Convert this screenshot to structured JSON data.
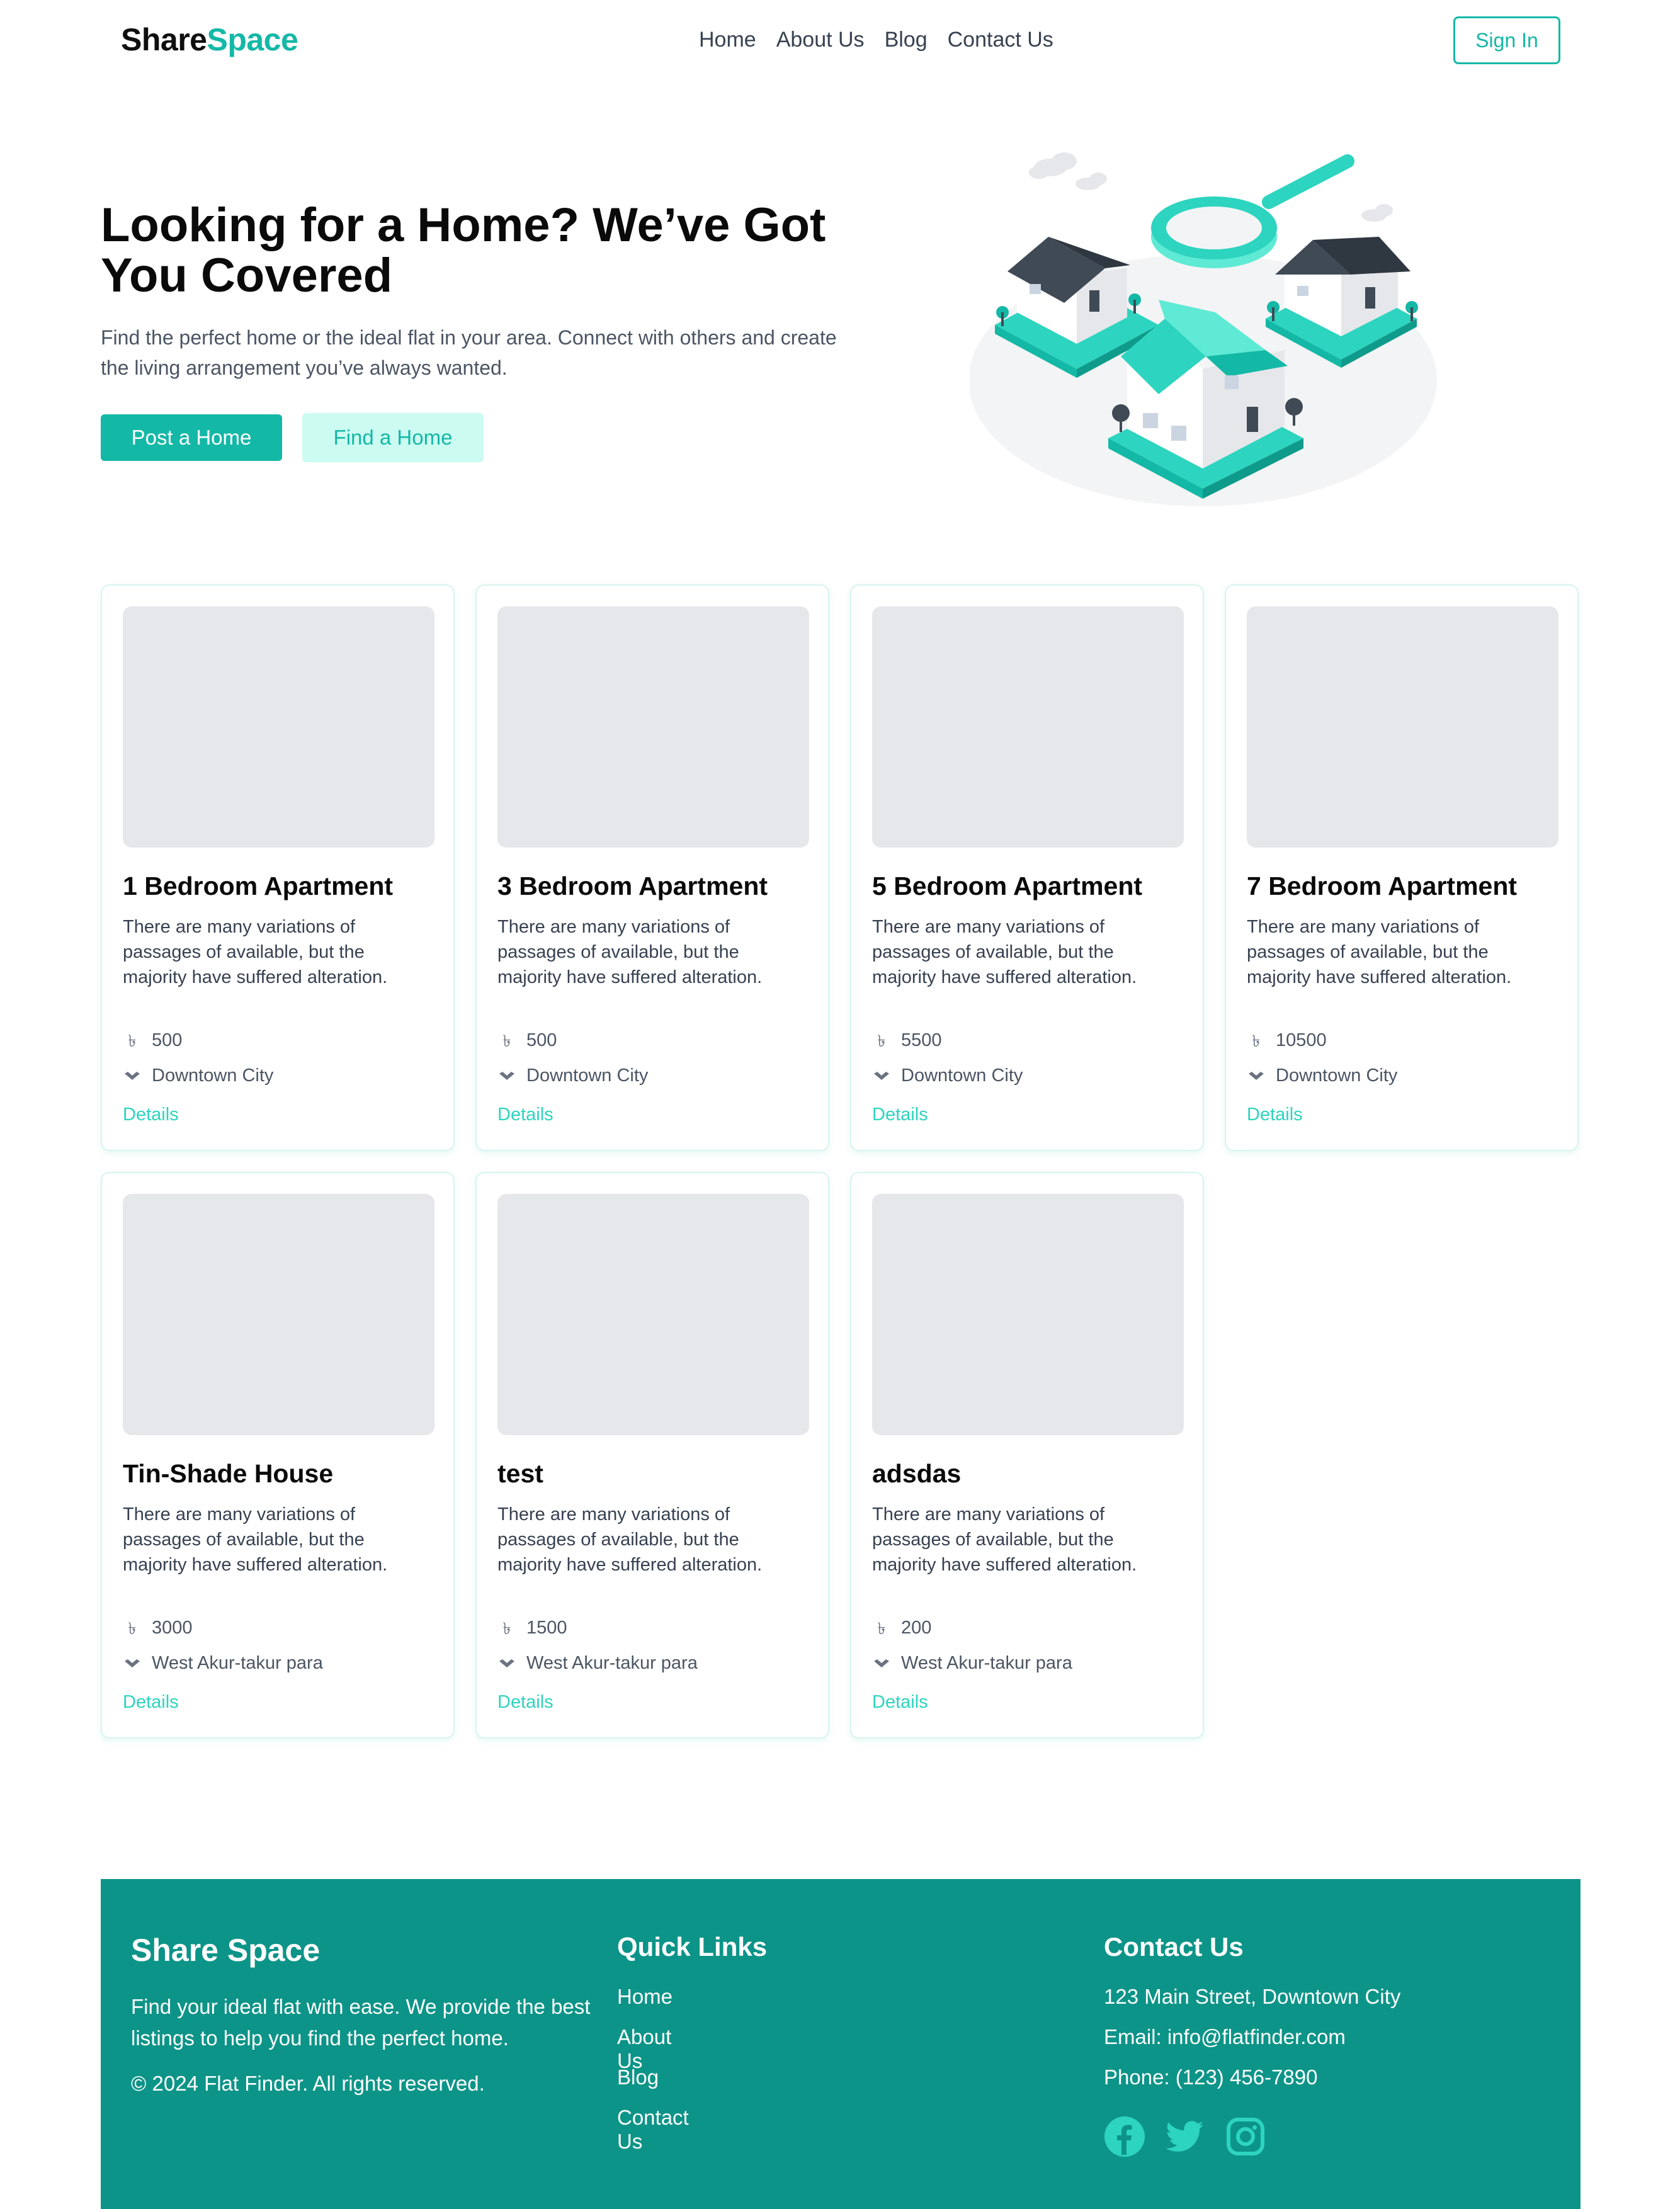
{
  "header": {
    "logo_part1": "Share",
    "logo_part2": "Space",
    "nav": [
      "Home",
      "About Us",
      "Blog",
      "Contact Us"
    ],
    "sign_in": "Sign In"
  },
  "hero": {
    "title": "Looking for a Home? We’ve Got You Covered",
    "subtitle": "Find the perfect home or the ideal flat in your area. Connect with others and create the living arrangement you’ve always wanted.",
    "post_button": "Post a Home",
    "find_button": "Find a Home"
  },
  "listings": [
    {
      "title": "1 Bedroom Apartment",
      "description": "There are many variations of passages of available, but the majority have suffered alteration.",
      "price": "500",
      "location": "Downtown City",
      "link": "Details"
    },
    {
      "title": "3 Bedroom Apartment",
      "description": "There are many variations of passages of available, but the majority have suffered alteration.",
      "price": "500",
      "location": "Downtown City",
      "link": "Details"
    },
    {
      "title": "5 Bedroom Apartment",
      "description": "There are many variations of passages of available, but the majority have suffered alteration.",
      "price": "5500",
      "location": "Downtown City",
      "link": "Details"
    },
    {
      "title": "7 Bedroom Apartment",
      "description": "There are many variations of passages of available, but the majority have suffered alteration.",
      "price": "10500",
      "location": "Downtown City",
      "link": "Details"
    },
    {
      "title": "Tin-Shade House",
      "description": "There are many variations of passages of available, but the majority have suffered alteration.",
      "price": "3000",
      "location": "West Akur-takur para",
      "link": "Details"
    },
    {
      "title": "test",
      "description": "There are many variations of passages of available, but the majority have suffered alteration.",
      "price": "1500",
      "location": "West Akur-takur para",
      "link": "Details"
    },
    {
      "title": "adsdas",
      "description": "There are many variations of passages of available, but the majority have suffered alteration.",
      "price": "200",
      "location": "West Akur-takur para",
      "link": "Details"
    }
  ],
  "footer": {
    "brand": "Share Space",
    "description": "Find your ideal flat with ease. We provide the best listings to help you find the perfect home.",
    "copyright": "© 2024 Flat Finder. All rights reserved.",
    "quick_links_heading": "Quick Links",
    "quick_links": [
      "Home",
      "About Us",
      "Blog",
      "Contact Us"
    ],
    "contact_heading": "Contact Us",
    "address": "123 Main Street, Downtown City",
    "email": "Email: info@flatfinder.com",
    "phone": "Phone: (123) 456-7890",
    "socials": [
      "facebook-icon",
      "twitter-icon",
      "instagram-icon"
    ]
  },
  "colors": {
    "brand": "#14b8a6",
    "brand_light": "#ccfbf1",
    "footer_bg": "#0d9488",
    "social_icon": "#2dd4bf"
  }
}
